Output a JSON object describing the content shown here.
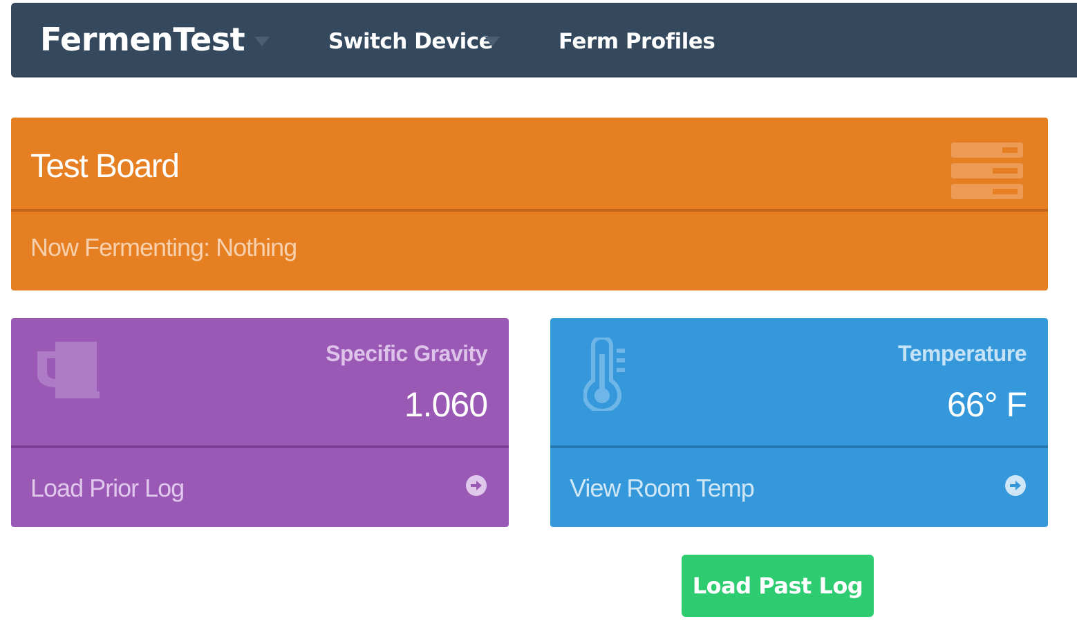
{
  "navbar": {
    "brand": "FermenTest",
    "links": [
      {
        "label": "Switch Device"
      },
      {
        "label": "Ferm Profiles"
      }
    ]
  },
  "board": {
    "title": "Test Board",
    "status": "Now Fermenting: Nothing",
    "icon": "server-icon"
  },
  "gravity_card": {
    "label": "Specific Gravity",
    "value": "1.060",
    "footer": "Load Prior Log",
    "icon": "beer-mug-icon"
  },
  "temperature_card": {
    "label": "Temperature",
    "value": "66° F",
    "footer": "View Room Temp",
    "icon": "thermometer-icon"
  },
  "load_past_log_button": "Load Past Log",
  "colors": {
    "navbar": "#34495e",
    "orange": "#e67e22",
    "purple": "#9b59b6",
    "blue": "#3498db",
    "green": "#2ecc71"
  }
}
